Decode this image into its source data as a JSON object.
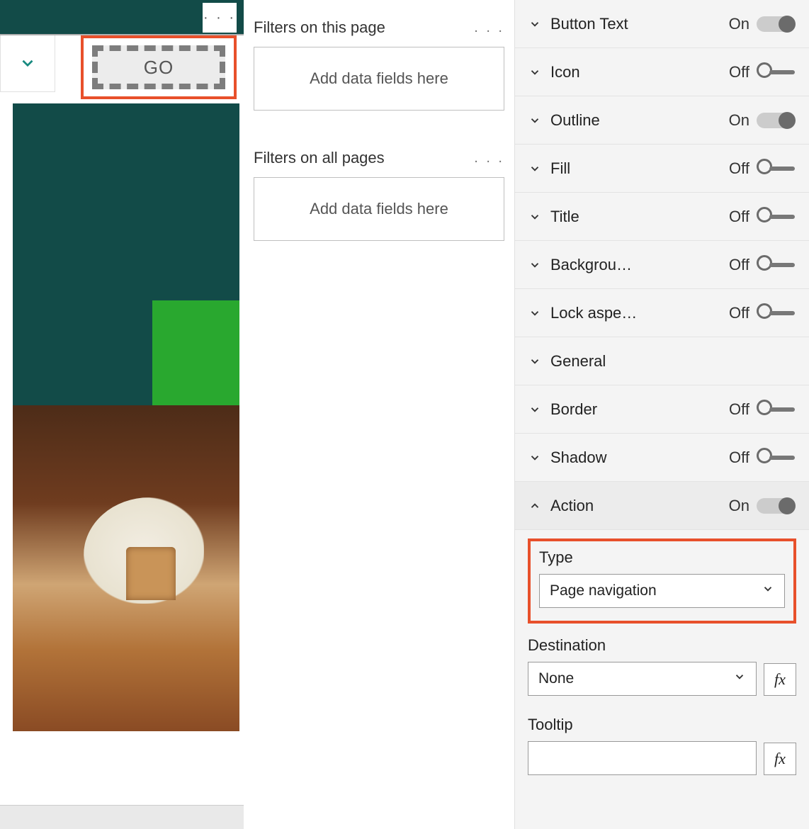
{
  "canvas": {
    "go_button_label": "GO",
    "more_dots": "· · ·"
  },
  "filters": {
    "page_header": "Filters on this page",
    "allpages_header": "Filters on all pages",
    "dropzone_text": "Add data fields here",
    "more_dots": ". . ."
  },
  "format": {
    "items": [
      {
        "label": "Button Text",
        "state": "On",
        "toggle": "on",
        "has_toggle": true,
        "expanded": false
      },
      {
        "label": "Icon",
        "state": "Off",
        "toggle": "off",
        "has_toggle": true,
        "expanded": false
      },
      {
        "label": "Outline",
        "state": "On",
        "toggle": "on",
        "has_toggle": true,
        "expanded": false
      },
      {
        "label": "Fill",
        "state": "Off",
        "toggle": "off",
        "has_toggle": true,
        "expanded": false
      },
      {
        "label": "Title",
        "state": "Off",
        "toggle": "off",
        "has_toggle": true,
        "expanded": false
      },
      {
        "label": "Backgrou…",
        "state": "Off",
        "toggle": "off",
        "has_toggle": true,
        "expanded": false
      },
      {
        "label": "Lock aspe…",
        "state": "Off",
        "toggle": "off",
        "has_toggle": true,
        "expanded": false
      },
      {
        "label": "General",
        "state": "",
        "toggle": "",
        "has_toggle": false,
        "expanded": false
      },
      {
        "label": "Border",
        "state": "Off",
        "toggle": "off",
        "has_toggle": true,
        "expanded": false
      },
      {
        "label": "Shadow",
        "state": "Off",
        "toggle": "off",
        "has_toggle": true,
        "expanded": false
      },
      {
        "label": "Action",
        "state": "On",
        "toggle": "on",
        "has_toggle": true,
        "expanded": true
      }
    ],
    "action": {
      "type_label": "Type",
      "type_value": "Page navigation",
      "destination_label": "Destination",
      "destination_value": "None",
      "tooltip_label": "Tooltip",
      "tooltip_value": "",
      "fx_label": "fx"
    }
  }
}
